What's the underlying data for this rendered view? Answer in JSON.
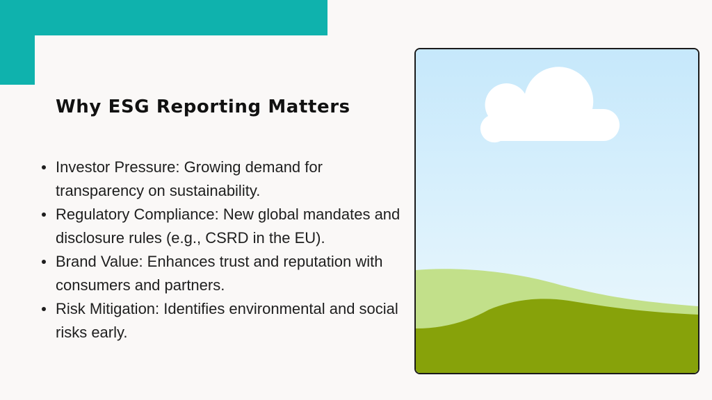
{
  "slide": {
    "title": "Why ESG Reporting Matters",
    "bullets": [
      "Investor Pressure: Growing demand for transparency on sustainability.",
      "Regulatory Compliance: New global mandates and disclosure rules (e.g., CSRD in the EU).",
      "Brand Value: Enhances trust and reputation with consumers and partners.",
      "Risk Mitigation: Identifies environmental and social risks early."
    ]
  },
  "colors": {
    "accent": "#0fb2ad",
    "background": "#faf8f7",
    "sky_top": "#c6e8fb",
    "sky_bottom": "#eef9fd",
    "hill_light": "#c2e08a",
    "hill_dark": "#87a20a",
    "cloud": "#ffffff"
  }
}
